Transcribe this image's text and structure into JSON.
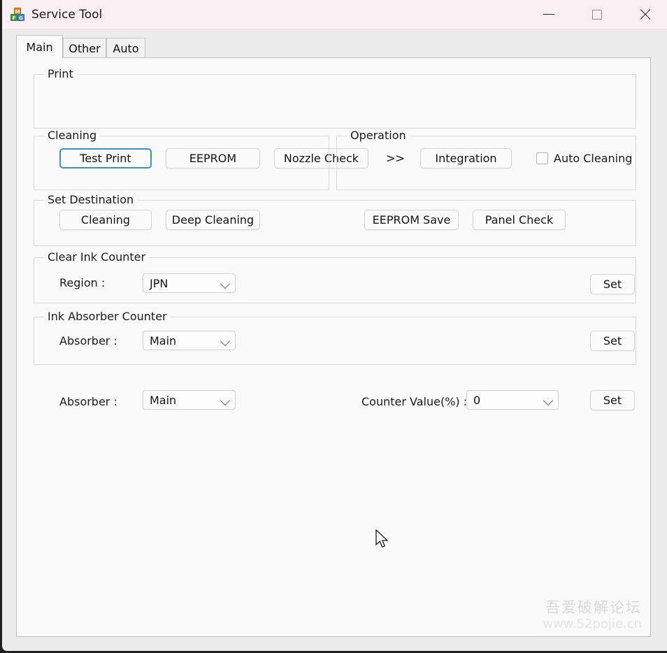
{
  "window": {
    "title": "Service Tool",
    "icon": "blocks-icon",
    "icon_blocks": [
      "M",
      "F",
      "G"
    ],
    "controls": {
      "minimize": "minimize-icon",
      "maximize": "maximize-icon",
      "close": "close-icon"
    },
    "accent_titlebar_color": "#faf0f4",
    "focus_color": "#3a8fd8"
  },
  "tabs": [
    {
      "label": "Main",
      "selected": true
    },
    {
      "label": "Other",
      "selected": false
    },
    {
      "label": "Auto",
      "selected": false
    }
  ],
  "groups": {
    "print": {
      "title": "Print",
      "buttons": [
        {
          "label": "Test Print",
          "focused": true
        },
        {
          "label": "EEPROM",
          "focused": false
        },
        {
          "label": "Nozzle Check",
          "focused": false
        },
        {
          "label": "Integration",
          "focused": false
        }
      ],
      "more_label": ">>",
      "checkbox": {
        "label": "Auto Cleaning",
        "checked": false
      }
    },
    "cleaning": {
      "title": "Cleaning",
      "buttons": [
        {
          "label": "Cleaning"
        },
        {
          "label": "Deep Cleaning"
        }
      ]
    },
    "operation": {
      "title": "Operation",
      "buttons": [
        {
          "label": "EEPROM Save"
        },
        {
          "label": "Panel Check"
        }
      ]
    },
    "set_destination": {
      "title": "Set Destination",
      "field_label": "Region :",
      "value": "JPN",
      "options": [
        "JPN"
      ],
      "set_label": "Set"
    },
    "clear_ink_counter": {
      "title": "Clear Ink Counter",
      "field_label": "Absorber :",
      "value": "Main",
      "options": [
        "Main"
      ],
      "set_label": "Set"
    },
    "ink_absorber_counter": {
      "title": "Ink Absorber Counter",
      "field_label": "Absorber :",
      "value": "Main",
      "options": [
        "Main"
      ],
      "counter_label": "Counter Value(%) :",
      "counter_value": "0",
      "counter_options": [
        "0"
      ],
      "set_label": "Set"
    }
  },
  "watermark": {
    "cn": "吾爱破解论坛",
    "url": "www.52pojie.cn"
  }
}
